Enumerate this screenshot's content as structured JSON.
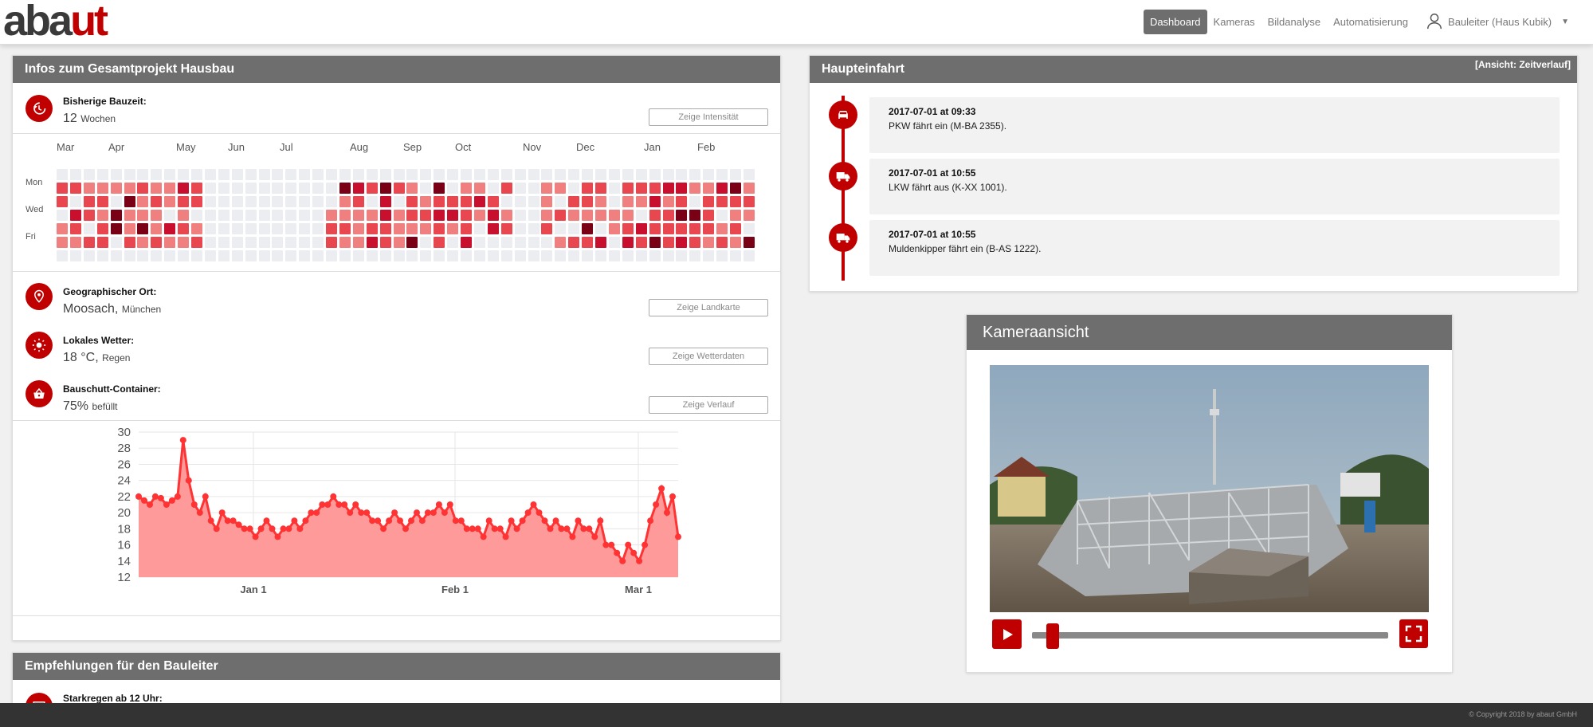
{
  "brand": {
    "logo_part1": "aba",
    "logo_part2": "ut"
  },
  "nav": {
    "items": [
      "Dashboard",
      "Kameras",
      "Bildanalyse",
      "Automatisierung"
    ],
    "active": "Dashboard",
    "user": "Bauleiter (Haus Kubik)"
  },
  "project": {
    "title": "Infos zum Gesamtprojekt Hausbau",
    "bauzeit": {
      "label": "Bisherige Bauzeit:",
      "value": "12",
      "unit": "Wochen",
      "button": "Zeige Intensität"
    },
    "heatmap": {
      "months": [
        "Mar",
        "Apr",
        "May",
        "Jun",
        "Jul",
        "Aug",
        "Sep",
        "Oct",
        "Nov",
        "Dec",
        "Jan",
        "Feb"
      ],
      "days": [
        "Mon",
        "Wed",
        "Fri"
      ],
      "colors": {
        "empty": "#ebedf0",
        "l1": "#f08080",
        "l2": "#e8474f",
        "l3": "#c8102e",
        "l4": "#7a0016"
      }
    },
    "ort": {
      "label": "Geographischer Ort:",
      "value": "Moosach,",
      "sub": "München",
      "button": "Zeige Landkarte"
    },
    "wetter": {
      "label": "Lokales Wetter:",
      "value": "18 °C,",
      "sub": "Regen",
      "button": "Zeige Wetterdaten"
    },
    "container": {
      "label": "Bauschutt-Container:",
      "value": "75%",
      "sub": "befüllt",
      "button": "Zeige Verlauf"
    }
  },
  "chart_data": {
    "type": "area",
    "yticks": [
      "30",
      "28",
      "26",
      "24",
      "22",
      "20",
      "18",
      "16",
      "14",
      "12"
    ],
    "ylim": [
      12,
      30
    ],
    "xticks": [
      "Jan 1",
      "Feb 1",
      "Mar 1"
    ],
    "color": "#ff3333",
    "values": [
      22,
      21.5,
      21,
      22,
      21.8,
      21,
      21.5,
      22,
      29,
      24,
      21,
      20,
      22,
      19,
      18,
      20,
      19,
      19,
      18.5,
      18,
      18,
      17,
      18,
      19,
      18,
      17,
      18,
      18,
      19,
      18,
      19,
      20,
      20,
      21,
      21,
      22,
      21,
      21,
      20,
      21,
      20,
      20,
      19,
      19,
      18,
      19,
      20,
      19,
      18,
      19,
      20,
      19,
      20,
      20,
      21,
      20,
      21,
      19,
      19,
      18,
      18,
      18,
      17,
      19,
      18,
      18,
      17,
      19,
      18,
      19,
      20,
      21,
      20,
      19,
      18,
      19,
      18,
      18,
      17,
      19,
      18,
      18,
      17,
      19,
      16,
      16,
      15,
      14,
      16,
      15,
      14,
      16,
      19,
      21,
      23,
      20,
      22,
      17
    ]
  },
  "recommendations": {
    "title": "Empfehlungen für den Bauleiter",
    "first": "Starkregen ab 12 Uhr:"
  },
  "entrance": {
    "title": "Haupteinfahrt",
    "view": "[Ansicht: Zeitverlauf]",
    "events": [
      {
        "time": "2017-07-01 at 09:33",
        "text": "PKW fährt ein (M-BA 2355).",
        "icon": "car-icon"
      },
      {
        "time": "2017-07-01 at 10:55",
        "text": "LKW fährt aus (K-XX 1001).",
        "icon": "truck-icon"
      },
      {
        "time": "2017-07-01 at 10:55",
        "text": "Muldenkipper fährt ein (B-AS 1222).",
        "icon": "truck-icon"
      }
    ]
  },
  "camera": {
    "title": "Kameraansicht",
    "progress": 0.04
  },
  "footer": {
    "copyright": "© Copyright 2018 by abaut GmbH"
  }
}
